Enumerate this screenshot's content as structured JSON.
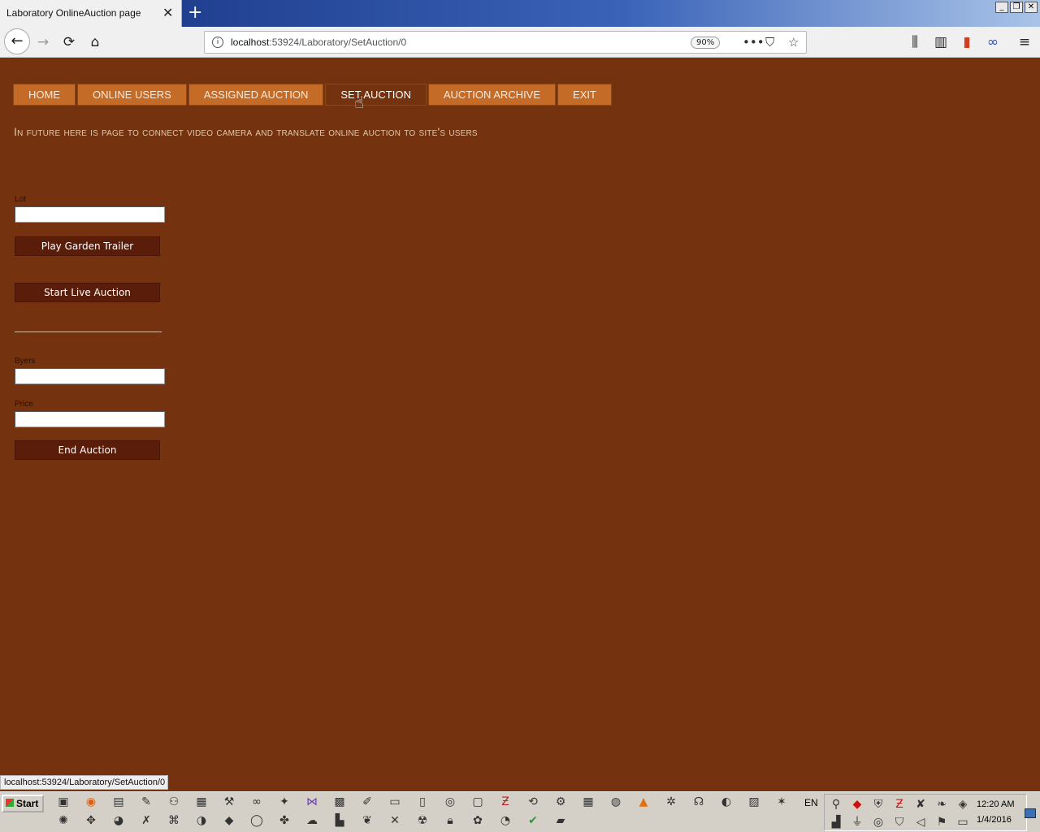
{
  "browser": {
    "tab_title": "Laboratory OnlineAuction page",
    "tab_close": "✕",
    "new_tab": "+",
    "url_host": "localhost",
    "url_path": ":53924/Laboratory/SetAuction/0",
    "zoom": "90%",
    "window_buttons": [
      "_",
      "❐",
      "✕"
    ]
  },
  "menu": {
    "items": [
      "HOME",
      "ONLINE USERS",
      "ASSIGNED AUCTION",
      "SET AUCTION",
      "AUCTION ARCHIVE",
      "EXIT"
    ],
    "active": "SET AUCTION"
  },
  "page": {
    "heading": "In future here is page to connect video camera and translate online auction to site's users",
    "lot_label": "Lot",
    "lot_value": "",
    "play_trailer_label": "Play Garden Trailer",
    "start_live_label": "Start Live Auction",
    "byers_label": "Byers",
    "byers_value": "",
    "price_label": "Price",
    "price_value": "",
    "end_auction_label": "End Auction"
  },
  "status_bar": {
    "text": "localhost:53924/Laboratory/SetAuction/0"
  },
  "taskbar": {
    "start_label": "Start",
    "language": "EN",
    "time": "12:20 AM",
    "date": "1/4/2016"
  }
}
